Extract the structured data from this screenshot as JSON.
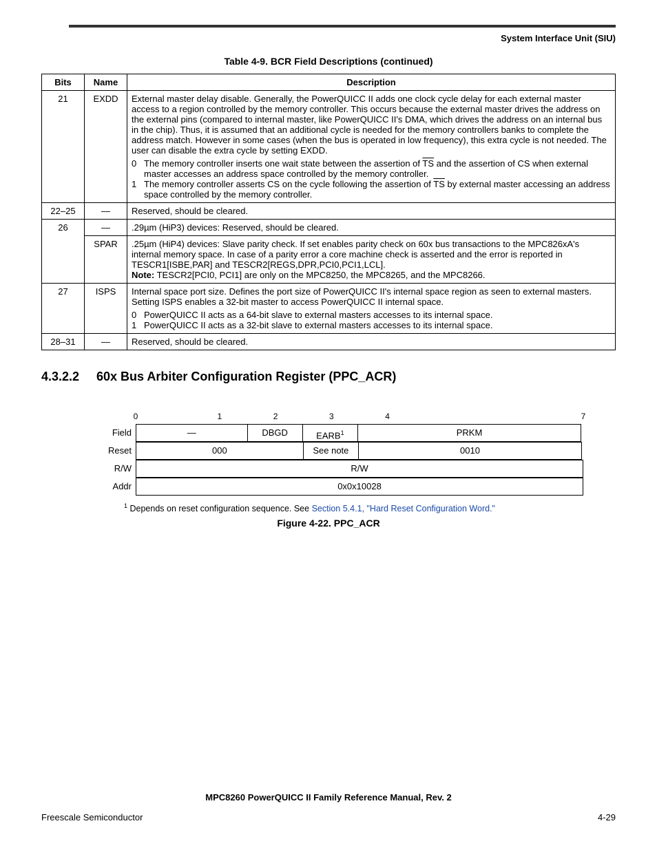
{
  "header": {
    "section": "System Interface Unit (SIU)"
  },
  "table49": {
    "caption": "Table 4-9. BCR Field Descriptions (continued)",
    "head": {
      "bits": "Bits",
      "name": "Name",
      "desc": "Description"
    },
    "rows": {
      "r21": {
        "bits": "21",
        "name": "EXDD",
        "body": "External master delay disable. Generally, the PowerQUICC II adds one clock cycle delay for each external master access to a region controlled by the memory controller. This occurs because the external master drives the address on the external pins (compared to internal master, like PowerQUICC II's DMA, which drives the address on an internal bus in the chip). Thus, it is assumed that an additional cycle is needed for the memory controllers banks to complete the address match. However in some cases (when the bus is operated in low frequency), this extra cycle is not needed. The user can disable the extra cycle by setting EXDD.",
        "li0_a": "The memory controller inserts one wait state between the assertion of ",
        "li0_ts": "TS",
        "li0_b": " and the assertion of CS when external master accesses an address space controlled by the memory controller.",
        "li1_a": "The memory controller asserts CS on the cycle following the assertion of ",
        "li1_ts": "TS",
        "li1_b": " by external master accessing an address space controlled by the memory controller."
      },
      "r22_25": {
        "bits": "22–25",
        "name": "—",
        "desc": "Reserved, should be cleared."
      },
      "r26a": {
        "bits": "26",
        "name": "—",
        "desc": ".29µm (HiP3) devices: Reserved, should be cleared."
      },
      "r26b": {
        "name": "SPAR",
        "body": ".25µm (HiP4) devices: Slave parity check. If set enables parity check on 60x bus transactions to the MPC826xA's internal memory space. In case of a parity error a core machine check is asserted and the error is reported in TESCR1[ISBE,PAR] and TESCR2[REGS,DPR,PCI0,PCI1,LCL].",
        "note_label": "Note:",
        "note_text": " TESCR2[PCI0, PCI1] are only on the MPC8250, the MPC8265, and the MPC8266."
      },
      "r27": {
        "bits": "27",
        "name": "ISPS",
        "body": "Internal space port size. Defines the port size of PowerQUICC II's internal space region as seen to external masters. Setting ISPS enables a 32-bit master to access PowerQUICC II internal space.",
        "li0": "PowerQUICC II acts as a 64-bit slave to external masters accesses to its internal space.",
        "li1": "PowerQUICC II acts as a 32-bit slave to external masters accesses to its internal space."
      },
      "r28_31": {
        "bits": "28–31",
        "name": "—",
        "desc": "Reserved, should be cleared."
      }
    }
  },
  "section": {
    "num": "4.3.2.2",
    "title": "60x Bus Arbiter Configuration Register (PPC_ACR)"
  },
  "reg": {
    "bitnums": {
      "b0": "0",
      "b1": "1",
      "b2": "2",
      "b3": "3",
      "b4": "4",
      "b7": "7"
    },
    "labels": {
      "field": "Field",
      "reset": "Reset",
      "rw": "R/W",
      "addr": "Addr"
    },
    "field": {
      "dash": "—",
      "dbgd": "DBGD",
      "earb": "EARB",
      "earb_sup": "1",
      "prkm": "PRKM"
    },
    "reset": {
      "c0": "000",
      "c1": "See note",
      "c2": "0010"
    },
    "rw": "R/W",
    "addr": "0x0x10028"
  },
  "footnote": {
    "sup": "1",
    "text": " Depends on reset configuration sequence. See ",
    "link": "Section 5.4.1, \"Hard Reset Configuration Word.\""
  },
  "figure_caption": "Figure 4-22. PPC_ACR",
  "footer": {
    "manual": "MPC8260 PowerQUICC II Family Reference Manual, Rev. 2",
    "left": "Freescale Semiconductor",
    "right": "4-29"
  }
}
